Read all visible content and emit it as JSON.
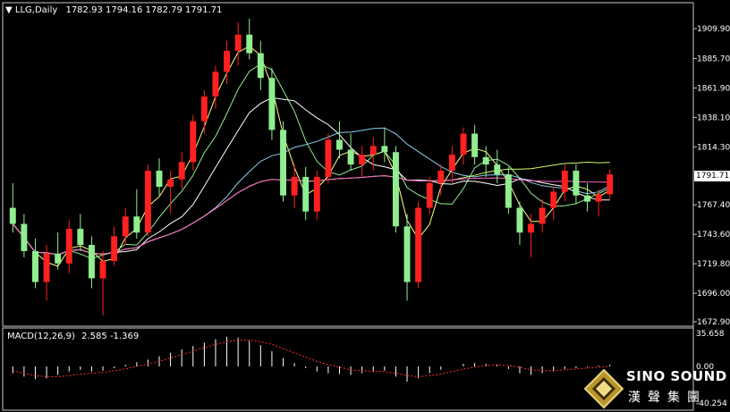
{
  "header": {
    "symbol_timeframe": "LLG,Daily",
    "ohlc": "1782.93 1794.16 1782.79 1791.71"
  },
  "macd_header": {
    "label": "MACD(12,26,9)",
    "values": "2.585 -1.369"
  },
  "price_axis": {
    "ticks": [
      "1909.90",
      "1885.70",
      "1861.90",
      "1838.10",
      "1814.30",
      "1767.40",
      "1743.60",
      "1719.80",
      "1696.00",
      "1672.90"
    ],
    "current_price": "1791.71"
  },
  "macd_axis": {
    "ticks": [
      "35.658",
      "0.00",
      "-40.254"
    ]
  },
  "logo": {
    "name": "SINO SOUND",
    "subtitle": "漢聲集團"
  },
  "colors": {
    "background": "#000000",
    "bull_candle": "#ff2020",
    "bear_candle": "#90ee90",
    "ma_lines": [
      "#ffff80",
      "#90ee90",
      "#ffffff",
      "#87ceeb",
      "#ccff66",
      "#ff66cc"
    ],
    "macd_signal": "#ff3030",
    "macd_hist": "#ffffff"
  },
  "chart_data": {
    "type": "candlestick",
    "title": "LLG,Daily",
    "ylim": [
      1672.9,
      1920.0
    ],
    "candles": [
      [
        1765,
        1785,
        1745,
        1752
      ],
      [
        1752,
        1760,
        1725,
        1730
      ],
      [
        1730,
        1740,
        1700,
        1705
      ],
      [
        1705,
        1735,
        1690,
        1728
      ],
      [
        1728,
        1745,
        1715,
        1720
      ],
      [
        1720,
        1755,
        1712,
        1748
      ],
      [
        1748,
        1760,
        1730,
        1735
      ],
      [
        1735,
        1742,
        1700,
        1708
      ],
      [
        1708,
        1730,
        1678,
        1722
      ],
      [
        1722,
        1750,
        1718,
        1742
      ],
      [
        1742,
        1765,
        1735,
        1758
      ],
      [
        1758,
        1780,
        1740,
        1745
      ],
      [
        1745,
        1800,
        1742,
        1795
      ],
      [
        1795,
        1805,
        1775,
        1782
      ],
      [
        1782,
        1795,
        1760,
        1788
      ],
      [
        1788,
        1810,
        1780,
        1802
      ],
      [
        1802,
        1840,
        1795,
        1835
      ],
      [
        1835,
        1860,
        1825,
        1855
      ],
      [
        1855,
        1880,
        1845,
        1875
      ],
      [
        1875,
        1900,
        1865,
        1892
      ],
      [
        1892,
        1915,
        1880,
        1905
      ],
      [
        1905,
        1918,
        1885,
        1890
      ],
      [
        1890,
        1900,
        1860,
        1870
      ],
      [
        1870,
        1878,
        1820,
        1828
      ],
      [
        1828,
        1835,
        1770,
        1775
      ],
      [
        1775,
        1800,
        1765,
        1790
      ],
      [
        1790,
        1798,
        1755,
        1762
      ],
      [
        1762,
        1795,
        1755,
        1790
      ],
      [
        1790,
        1825,
        1785,
        1820
      ],
      [
        1820,
        1835,
        1805,
        1812
      ],
      [
        1812,
        1825,
        1795,
        1800
      ],
      [
        1800,
        1815,
        1790,
        1808
      ],
      [
        1808,
        1822,
        1795,
        1815
      ],
      [
        1815,
        1830,
        1802,
        1810
      ],
      [
        1810,
        1815,
        1745,
        1750
      ],
      [
        1750,
        1760,
        1690,
        1705
      ],
      [
        1705,
        1770,
        1700,
        1765
      ],
      [
        1765,
        1790,
        1760,
        1785
      ],
      [
        1785,
        1800,
        1775,
        1795
      ],
      [
        1795,
        1815,
        1785,
        1808
      ],
      [
        1808,
        1830,
        1800,
        1825
      ],
      [
        1825,
        1832,
        1800,
        1806
      ],
      [
        1806,
        1815,
        1790,
        1800
      ],
      [
        1800,
        1812,
        1785,
        1792
      ],
      [
        1792,
        1798,
        1760,
        1765
      ],
      [
        1765,
        1770,
        1735,
        1745
      ],
      [
        1745,
        1760,
        1725,
        1752
      ],
      [
        1752,
        1772,
        1745,
        1765
      ],
      [
        1765,
        1782,
        1755,
        1778
      ],
      [
        1778,
        1800,
        1770,
        1795
      ],
      [
        1795,
        1800,
        1768,
        1775
      ],
      [
        1775,
        1785,
        1762,
        1770
      ],
      [
        1770,
        1780,
        1758,
        1776
      ],
      [
        1776,
        1796,
        1772,
        1792
      ]
    ],
    "macd_histogram": [
      -8,
      -12,
      -15,
      -14,
      -10,
      -6,
      -4,
      -6,
      -5,
      -2,
      2,
      5,
      8,
      12,
      16,
      20,
      24,
      28,
      32,
      35,
      34,
      30,
      25,
      18,
      10,
      4,
      -2,
      -6,
      -8,
      -9,
      -10,
      -8,
      -6,
      -5,
      -12,
      -18,
      -14,
      -8,
      -4,
      0,
      3,
      4,
      3,
      2,
      -3,
      -8,
      -10,
      -8,
      -6,
      -3,
      -2,
      -1,
      1,
      2
    ],
    "macd_signal": [
      -5,
      -8,
      -11,
      -12,
      -12,
      -11,
      -9,
      -8,
      -7,
      -5,
      -3,
      0,
      3,
      6,
      10,
      14,
      18,
      22,
      26,
      29,
      31,
      31,
      29,
      26,
      21,
      16,
      11,
      6,
      2,
      -1,
      -4,
      -5,
      -6,
      -6,
      -8,
      -11,
      -12,
      -11,
      -9,
      -6,
      -3,
      -1,
      1,
      2,
      1,
      -1,
      -4,
      -5,
      -5,
      -4,
      -3,
      -2,
      -1,
      0
    ],
    "xlabel": "",
    "ylabel": ""
  }
}
